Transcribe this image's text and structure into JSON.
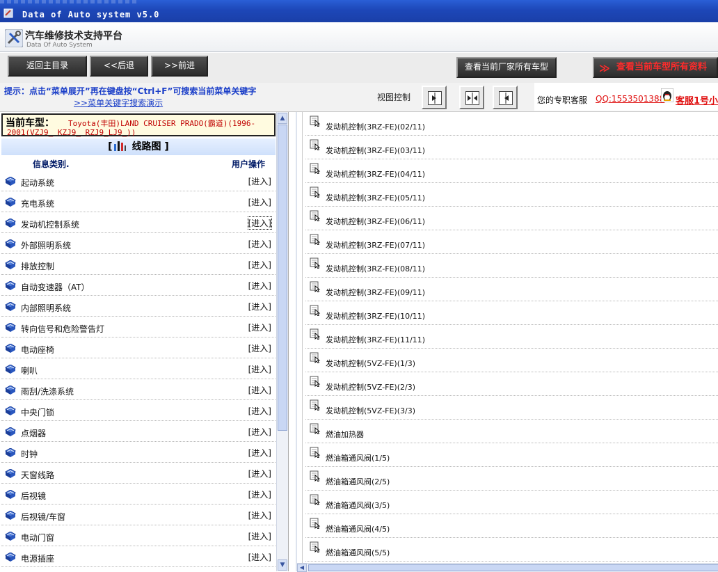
{
  "window": {
    "title": "Data of Auto system v5.0"
  },
  "header": {
    "app_name": "汽车维修技术支持平台",
    "app_subtitle": "Data Of Auto System"
  },
  "toolbar": {
    "home_label": "返回主目录",
    "back_label": "<<后退",
    "forward_label": ">>前进",
    "manufacturer_models_label": "查看当前厂家所有车型",
    "all_data_label": "查看当前车型所有资料",
    "all_data_prefix": "≫"
  },
  "hint": {
    "text": "提示：点击“菜单展开”再在键盘按“Ctrl+F”可搜索当前菜单关键字",
    "demo_link": ">>菜单关键字搜索演示"
  },
  "view_control": {
    "label": "视图控制"
  },
  "service": {
    "label": "您的专职客服",
    "qq": "QQ:1553501388",
    "agent": "客服1号小"
  },
  "vehicle": {
    "label": "当前车型：",
    "line1": "Toyota(丰田)LAND CRUISER PRADO(霸道)(1996-",
    "line2": "2001(VZJ9_ KZJ9_ RZJ9_LJ9_))"
  },
  "section": {
    "title": "线路图"
  },
  "category_table": {
    "col_type": "信息类别.",
    "col_action": "用户操作",
    "enter_label": "[进入]",
    "rows": [
      "起动系统",
      "充电系统",
      "发动机控制系统",
      "外部照明系统",
      "排放控制",
      "自动变速器（AT）",
      "内部照明系统",
      "转向信号和危险警告灯",
      "电动座椅",
      "喇叭",
      "雨刮/洗涤系统",
      "中央门锁",
      "点烟器",
      "时钟",
      "天窗线路",
      "后视镜",
      "后视镜/车窗",
      "电动门窗",
      "电源插座"
    ]
  },
  "documents": [
    "发动机控制(3RZ-FE)(02/11)",
    "发动机控制(3RZ-FE)(03/11)",
    "发动机控制(3RZ-FE)(04/11)",
    "发动机控制(3RZ-FE)(05/11)",
    "发动机控制(3RZ-FE)(06/11)",
    "发动机控制(3RZ-FE)(07/11)",
    "发动机控制(3RZ-FE)(08/11)",
    "发动机控制(3RZ-FE)(09/11)",
    "发动机控制(3RZ-FE)(10/11)",
    "发动机控制(3RZ-FE)(11/11)",
    "发动机控制(5VZ-FE)(1/3)",
    "发动机控制(5VZ-FE)(2/3)",
    "发动机控制(5VZ-FE)(3/3)",
    "燃油加热器",
    "燃油箱通风阀(1/5)",
    "燃油箱通风阀(2/5)",
    "燃油箱通风阀(3/5)",
    "燃油箱通风阀(4/5)",
    "燃油箱通风阀(5/5)"
  ],
  "icons": {
    "category": "book-icon",
    "document": "cursor-doc-icon"
  },
  "colors": {
    "title_bar": "#1d47b8",
    "hint_text": "#1a3ec8",
    "vehicle_text": "#c00000",
    "accent_red": "#ff2b2b"
  }
}
